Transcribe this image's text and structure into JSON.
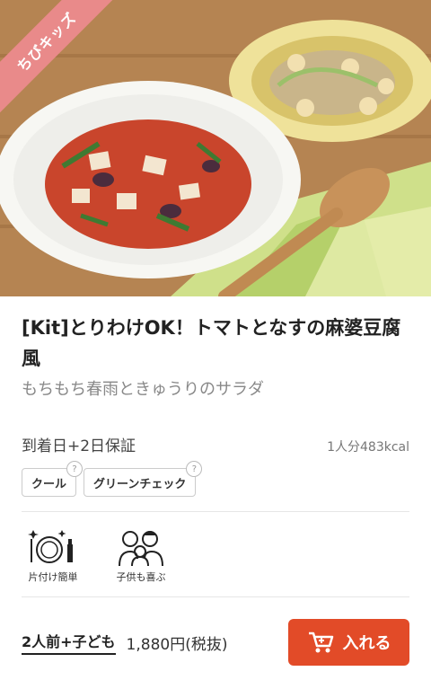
{
  "hero": {
    "badge": "ちびキッズ"
  },
  "product": {
    "title": "[Kit]とりわけOK！トマトとなすの麻婆豆腐風",
    "subtitle": "もちもち春雨ときゅうりのサラダ",
    "delivery": "到着日+2日保証",
    "calorie": "1人分483kcal",
    "tags": [
      {
        "label": "クール",
        "help": "?"
      },
      {
        "label": "グリーンチェック",
        "help": "?"
      }
    ],
    "features": [
      {
        "label": "片付け簡単",
        "icon": "easy-cleanup-icon"
      },
      {
        "label": "子供も喜ぶ",
        "icon": "kids-happy-icon"
      }
    ]
  },
  "purchase": {
    "serving": "2人前+子ども",
    "price": "1,880円(税抜)",
    "cart_label": "入れる"
  },
  "colors": {
    "accent": "#e24b28",
    "badge": "#e98a8a"
  }
}
